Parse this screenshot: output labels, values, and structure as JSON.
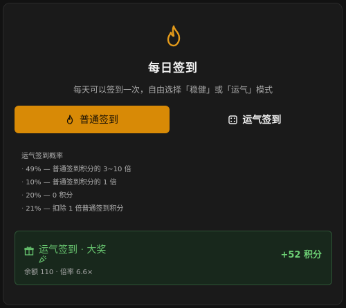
{
  "header": {
    "icon": "flame-icon",
    "title": "每日签到",
    "subtitle": "每天可以签到一次，自由选择「稳健」或「运气」模式"
  },
  "buttons": {
    "normal": {
      "label": "普通签到",
      "icon": "flame-icon",
      "color": "#d88a06"
    },
    "luck": {
      "label": "运气签到",
      "icon": "dice-icon"
    }
  },
  "probability": {
    "title": "运气签到概率",
    "items": [
      "49% — 普通签到积分的 3~10 倍",
      "10% — 普通签到积分的 1 倍",
      "20% — 0 积分",
      "21% — 扣除 1 倍普通签到积分"
    ]
  },
  "result": {
    "icon": "gift-icon",
    "title": "运气签到 · 大奖",
    "title_icon": "party-popper-icon",
    "meta": "余额 110 · 倍率 6.6×",
    "points": "+52 积分",
    "color": "#67c46f"
  }
}
